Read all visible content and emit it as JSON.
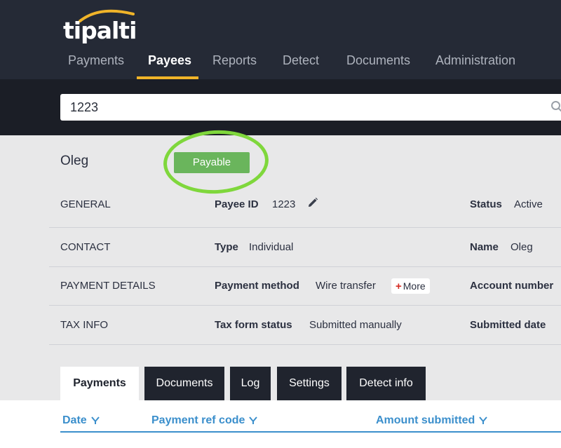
{
  "app": {
    "logo_text": "tipalti"
  },
  "nav": {
    "items": [
      {
        "label": "Payments",
        "active": false
      },
      {
        "label": "Payees",
        "active": true
      },
      {
        "label": "Reports",
        "active": false
      },
      {
        "label": "Detect",
        "active": false
      },
      {
        "label": "Documents",
        "active": false
      },
      {
        "label": "Administration",
        "active": false
      }
    ],
    "accent_color": "#f0b429"
  },
  "search": {
    "value": "1223",
    "icon": "search-icon"
  },
  "payee": {
    "name": "Oleg",
    "status_badge": "Payable",
    "badge_color": "#6ab55c"
  },
  "sections": {
    "general": {
      "label": "GENERAL",
      "payee_id_label": "Payee ID",
      "payee_id_value": "1223",
      "status_label": "Status",
      "status_value": "Active"
    },
    "contact": {
      "label": "CONTACT",
      "type_label": "Type",
      "type_value": "Individual",
      "name_label": "Name",
      "name_value": "Oleg"
    },
    "payment_details": {
      "label": "PAYMENT DETAILS",
      "method_label": "Payment method",
      "method_value": "Wire transfer",
      "more_plus": "+",
      "more_label": "More",
      "account_label": "Account number"
    },
    "tax_info": {
      "label": "TAX INFO",
      "form_status_label": "Tax form status",
      "form_status_value": "Submitted manually",
      "submitted_date_label": "Submitted date"
    }
  },
  "tabs": [
    {
      "label": "Payments",
      "active": true
    },
    {
      "label": "Documents",
      "active": false
    },
    {
      "label": "Log",
      "active": false
    },
    {
      "label": "Settings",
      "active": false
    },
    {
      "label": "Detect info",
      "active": false
    }
  ],
  "table": {
    "columns": [
      "Date",
      "Payment ref code",
      "Amount submitted"
    ],
    "header_color": "#3b8fcc"
  }
}
